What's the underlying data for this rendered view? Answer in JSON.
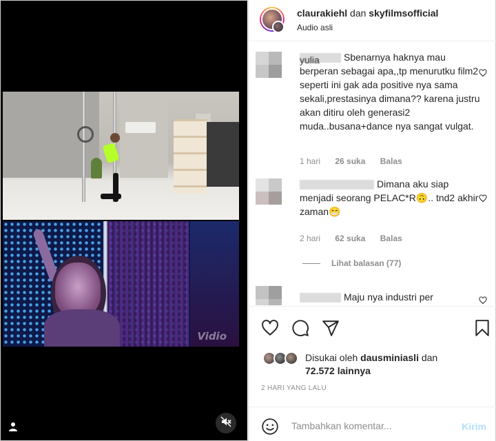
{
  "post": {
    "author": "claurakiehl",
    "connector": " dan ",
    "collaborator": "skyfilmsofficial",
    "audio": "Audio asli"
  },
  "media": {
    "watermark": "Vidio",
    "user_icon": "user-icon",
    "mute_icon": "volume-muted-icon"
  },
  "comments": [
    {
      "username": "yulia",
      "text": "Sbenarnya haknya mau berperan sebagai apa,,tp menurutku film2 seperti ini gak ada positive nya sama sekali,prestasinya dimana?? karena justru akan ditiru oleh generasi2 muda..busana+dance nya sangat vulgat.",
      "age": "1 hari",
      "likes": "26 suka",
      "reply": "Balas"
    },
    {
      "username": "",
      "text": "Dimana aku siap menjadi seorang PELAC*R🙃.. tnd2 akhir zaman😁",
      "age": "2 hari",
      "likes": "62 suka",
      "reply": "Balas"
    },
    {
      "username": "",
      "text": "Maju nya industri per",
      "age": "",
      "likes": "",
      "reply": ""
    }
  ],
  "view_replies": "Lihat balasan (77)",
  "actions": {
    "like_icon": "heart-icon",
    "comment_icon": "comment-icon",
    "share_icon": "share-icon",
    "save_icon": "bookmark-icon"
  },
  "likes_summary": {
    "prefix": "Disukai oleh ",
    "user": "dausminiasli",
    "middle": " dan",
    "count": "72.572 lainnya"
  },
  "date": "2 HARI YANG LALU",
  "add_comment": {
    "placeholder": "Tambahkan komentar...",
    "post_label": "Kirim"
  },
  "colors": {
    "text": "#262626",
    "muted": "#8e8e8e",
    "post_button_disabled": "#b2dffc",
    "media_bg": "#000000"
  }
}
